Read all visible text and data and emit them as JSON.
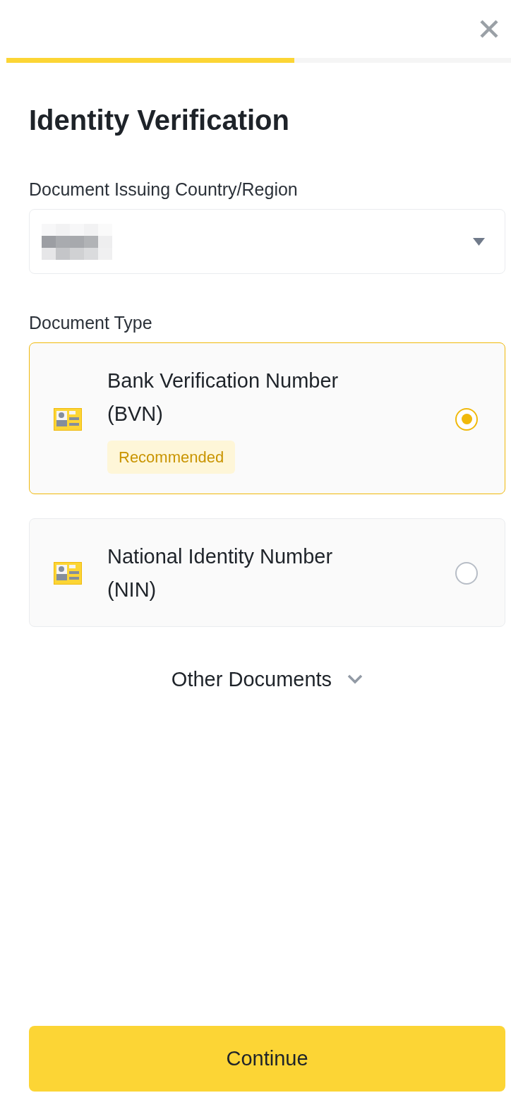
{
  "progress": {
    "level": 0.57
  },
  "title": "Identity Verification",
  "country_field": {
    "label": "Document Issuing Country/Region",
    "value_redacted": true
  },
  "document_type": {
    "label": "Document Type",
    "options": [
      {
        "name": "Bank Verification Number (BVN)",
        "badge": "Recommended",
        "selected": true
      },
      {
        "name": "National Identity Number (NIN)",
        "selected": false
      }
    ]
  },
  "other_documents": {
    "label": "Other Documents",
    "expanded": false
  },
  "continue_button": {
    "label": "Continue"
  }
}
